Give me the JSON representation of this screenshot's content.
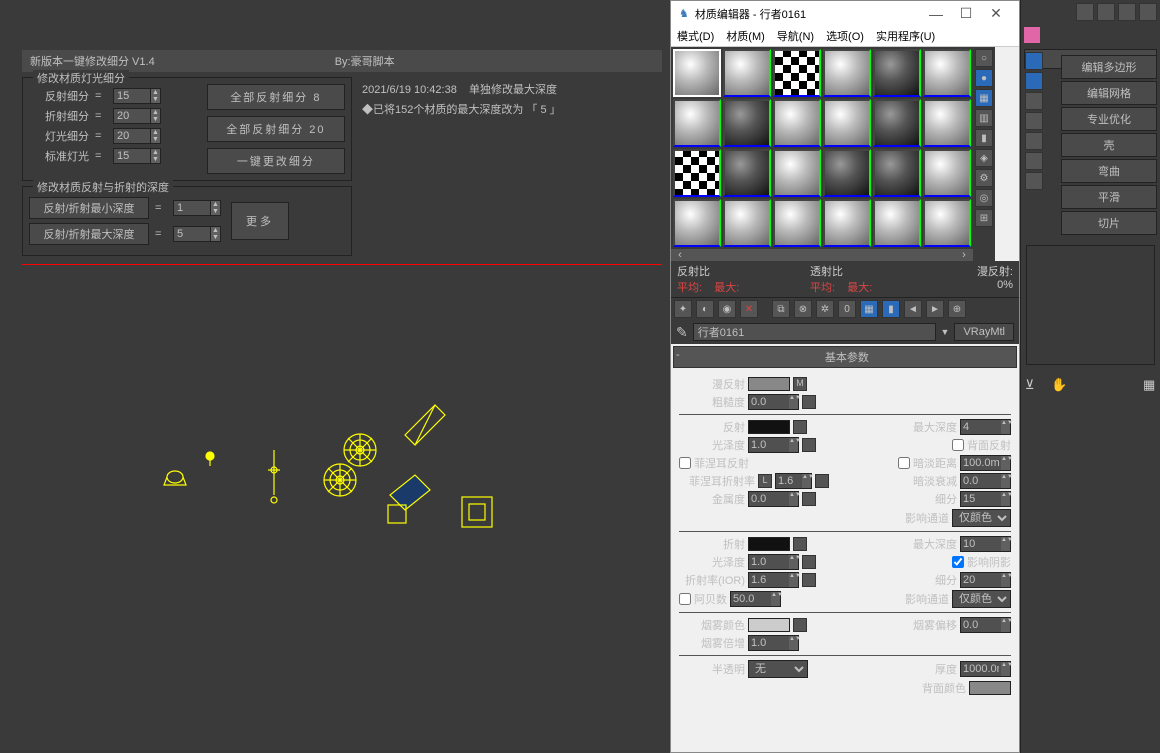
{
  "script": {
    "title": "新版本一键修改细分 V1.4",
    "author": "By:豪哥脚本",
    "group_light": "修改材质灯光细分",
    "reflect_sub": "反射细分",
    "reflect_sub_val": "15",
    "refract_sub": "折射细分",
    "refract_sub_val": "20",
    "light_sub": "灯光细分",
    "light_sub_val": "20",
    "std_light": "标准灯光",
    "std_light_val": "15",
    "btn_all_reflect8": "全部反射细分 8",
    "btn_all_reflect20": "全部反射细分 20",
    "btn_one_change": "一键更改细分",
    "group_depth": "修改材质反射与折射的深度",
    "min_depth": "反射/折射最小深度",
    "min_depth_val": "1",
    "max_depth": "反射/折射最大深度",
    "max_depth_val": "5",
    "btn_more": "更多",
    "log_time": "2021/6/19 10:42:38",
    "log_msg": "单独修改最大深度",
    "log_bullet": "◆已将152个材质的最大深度改为 「 5 」"
  },
  "mat": {
    "title": "材质编辑器 - 行者0161",
    "menu": [
      "模式(D)",
      "材质(M)",
      "导航(N)",
      "选项(O)",
      "实用程序(U)"
    ],
    "stats": {
      "reflect": "反射比",
      "trans": "透射比",
      "avg": "平均:",
      "max": "最大:",
      "diffuse": "漫反射:",
      "diff_val": "0%"
    },
    "name": "行者0161",
    "type": "VRayMtl",
    "rollup": "基本参数",
    "diffuse": "漫反射",
    "roughness": "粗糙度",
    "rough_val": "0.0",
    "reflect": "反射",
    "gloss": "光泽度",
    "gloss_val": "1.0",
    "maxdepth": "最大深度",
    "r_maxdepth_val": "4",
    "backface": "背面反射",
    "fresnel": "菲涅耳反射",
    "dimdist": "暗淡距离",
    "dimdist_val": "100.0mm",
    "fresnel_ior": "菲涅耳折射率",
    "f_ior_l": "L",
    "f_ior_val": "1.6",
    "dimfall": "暗淡衰减",
    "dimfall_val": "0.0",
    "metal": "金属度",
    "metal_val": "0.0",
    "subdiv": "细分",
    "subdiv_val": "15",
    "affectch": "影响通道",
    "affectch_val": "仅颜色",
    "refract": "折射",
    "t_maxdepth_val": "10",
    "affectsh": "影响阴影",
    "ior": "折射率(IOR)",
    "ior_val": "1.6",
    "t_subdiv_val": "20",
    "abbe": "阿贝数",
    "abbe_val": "50.0",
    "fog": "烟雾颜色",
    "fogbias": "烟雾偏移",
    "fogbias_val": "0.0",
    "fogmult": "烟雾倍增",
    "fogmult_val": "1.0",
    "translucent": "半透明",
    "trans_type": "无",
    "thick": "厚度",
    "thick_val": "1000.0m",
    "backsidecol": "背面颜色"
  },
  "rp": {
    "combo": " ",
    "buttons": [
      "编辑多边形",
      "编辑网格",
      "专业优化",
      "壳",
      "弯曲",
      "平滑",
      "切片"
    ]
  }
}
